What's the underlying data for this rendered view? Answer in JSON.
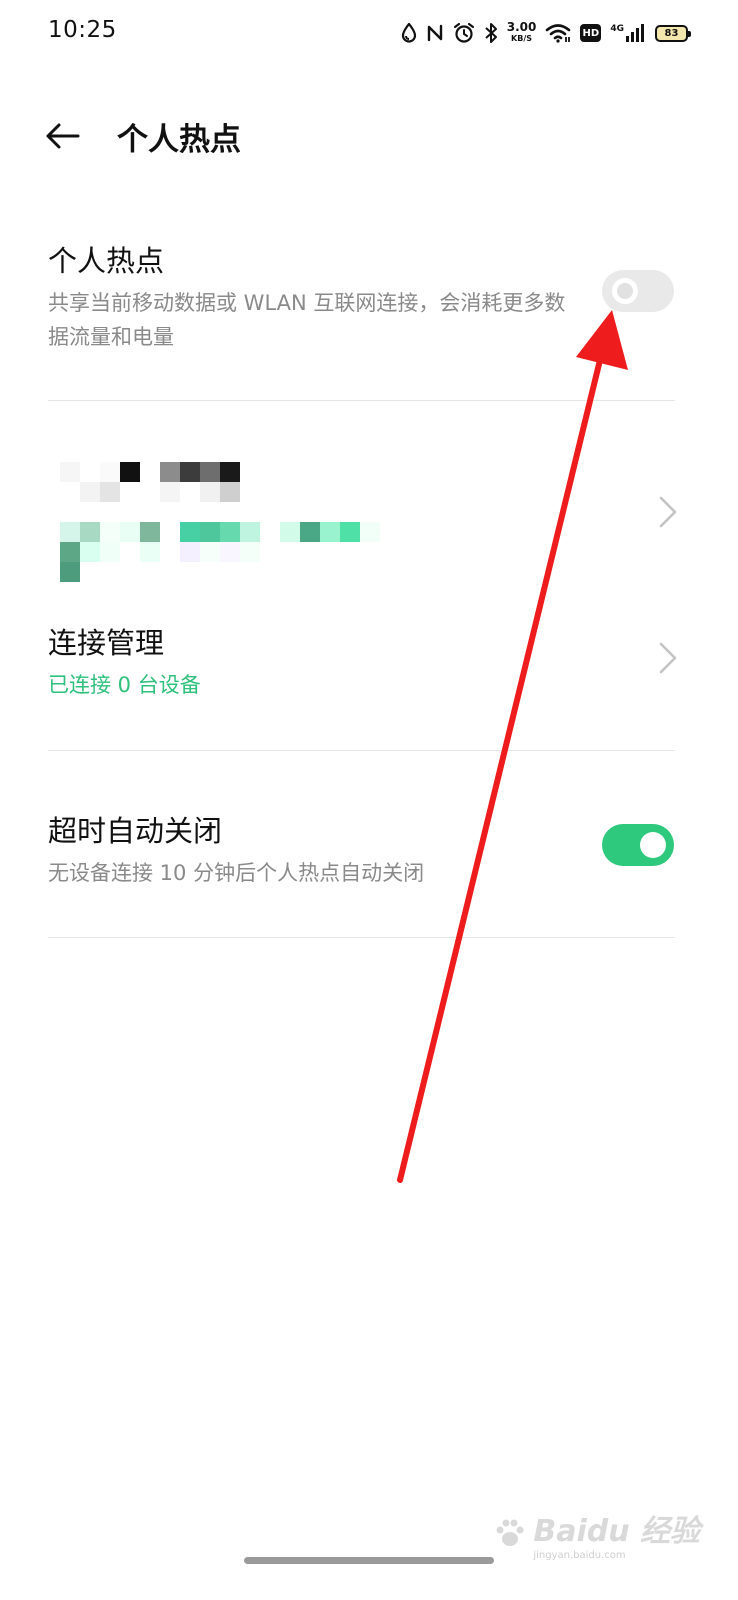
{
  "status_bar": {
    "time": "10:25",
    "speed_value": "3.00",
    "speed_unit": "KB/S",
    "hd_label": "HD",
    "network_label": "4G",
    "battery": "83",
    "icons": [
      "water-drop-icon",
      "nfc-icon",
      "alarm-icon",
      "bluetooth-icon",
      "wifi-icon",
      "cell-signal-icon"
    ]
  },
  "header": {
    "back_icon": "back-arrow-icon",
    "title": "个人热点"
  },
  "hotspot": {
    "title": "个人热点",
    "subtitle": "共享当前移动数据或 WLAN 互联网连接，会消耗更多数据流量和电量",
    "toggle_on": false
  },
  "network_entry": {
    "content": "redacted",
    "chevron_icon": "chevron-right-icon"
  },
  "connection_management": {
    "title": "连接管理",
    "subtitle": "已连接 0 台设备",
    "accent_color": "#2fc07c",
    "chevron_icon": "chevron-right-icon"
  },
  "auto_off": {
    "title": "超时自动关闭",
    "subtitle": "无设备连接 10 分钟后个人热点自动关闭",
    "toggle_on": true
  },
  "annotation": {
    "arrow_color": "#ee1c1c",
    "points_to": "hotspot toggle"
  },
  "watermark": {
    "text": "Baidu 经验",
    "sub": "jingyan.baidu.com"
  },
  "colors": {
    "accent_green": "#2fc97e",
    "toggle_off": "#e9e9e9",
    "divider": "#e6e6e6"
  }
}
